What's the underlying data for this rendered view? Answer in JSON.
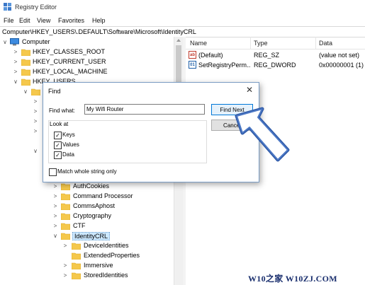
{
  "window": {
    "title": "Registry Editor"
  },
  "menu": [
    "File",
    "Edit",
    "View",
    "Favorites",
    "Help"
  ],
  "address": "Computer\\HKEY_USERS\\.DEFAULT\\Software\\Microsoft\\IdentityCRL",
  "tree": {
    "root": "Computer",
    "hives": [
      "HKEY_CLASSES_ROOT",
      "HKEY_CURRENT_USER",
      "HKEY_LOCAL_MACHINE",
      "HKEY_USERS"
    ],
    "keys": [
      "AuthCookies",
      "Command Processor",
      "CommsAphost",
      "Cryptography",
      "CTF",
      "IdentityCRL"
    ],
    "subkeys": [
      "DeviceIdentities",
      "ExtendedProperties",
      "Immersive",
      "StoredIdentities"
    ]
  },
  "list": {
    "columns": [
      "Name",
      "Type",
      "Data"
    ],
    "rows": [
      {
        "name": "(Default)",
        "type": "REG_SZ",
        "data": "(value not set)",
        "icon": "string-value-icon"
      },
      {
        "name": "SetRegistryPerm...",
        "type": "REG_DWORD",
        "data": "0x00000001 (1)",
        "icon": "dword-value-icon"
      }
    ]
  },
  "dialog": {
    "title": "Find",
    "find_what_label": "Find what:",
    "find_what_value": "My Wifi Router",
    "find_next": "Find Next",
    "cancel": "Cancel",
    "look_at": "Look at",
    "keys": "Keys",
    "values": "Values",
    "data": "Data",
    "match_whole": "Match whole string only",
    "checked": {
      "keys": true,
      "values": true,
      "data": true,
      "match_whole": false
    }
  },
  "watermark": "W10之家 W10ZJ.COM",
  "colors": {
    "selection": "#cce8ff",
    "arrow": "#2f5aa8",
    "folder": "#f5c84c"
  }
}
